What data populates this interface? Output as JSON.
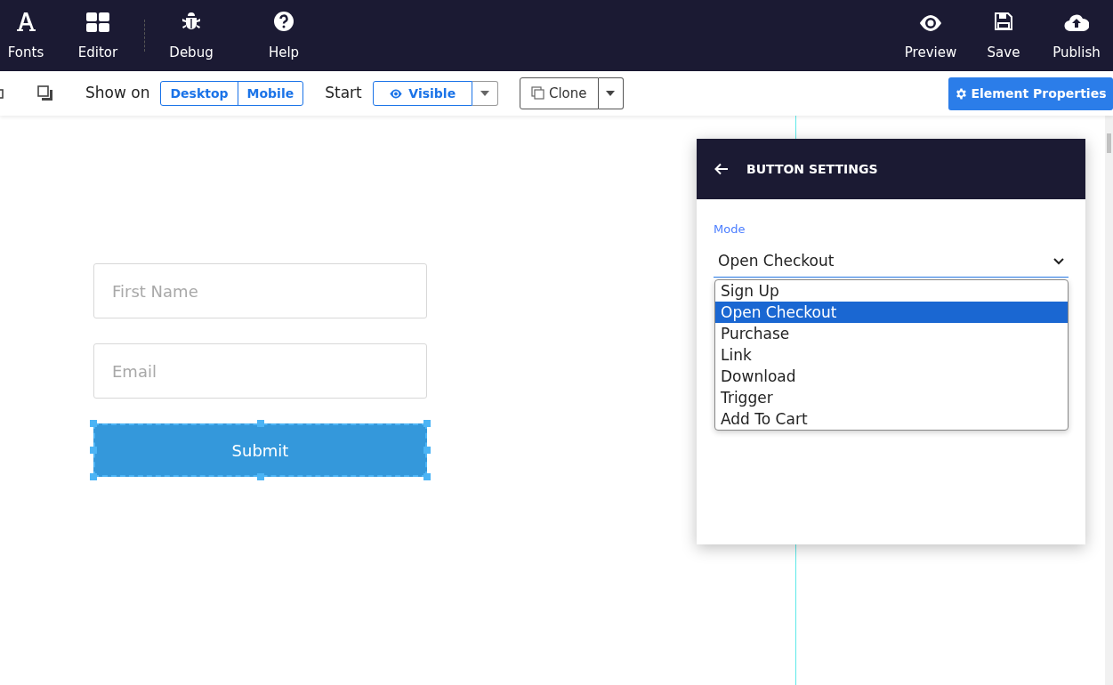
{
  "top_nav": {
    "left": [
      {
        "label": "Fonts",
        "kind": "fonts"
      },
      {
        "label": "Editor",
        "kind": "editor"
      },
      {
        "label": "Debug",
        "kind": "debug"
      },
      {
        "label": "Help",
        "kind": "help"
      }
    ],
    "right": [
      {
        "label": "Preview",
        "kind": "preview"
      },
      {
        "label": "Save",
        "kind": "save"
      },
      {
        "label": "Publish",
        "kind": "publish"
      }
    ]
  },
  "toolbar": {
    "show_on_label": "Show on",
    "show_on_options": [
      "Desktop",
      "Mobile"
    ],
    "start_label": "Start",
    "start_value": "Visible",
    "clone_label": "Clone",
    "properties_button": "Element Properties"
  },
  "form": {
    "fields": [
      {
        "placeholder": "First Name"
      },
      {
        "placeholder": "Email"
      }
    ],
    "submit": "Submit"
  },
  "panel": {
    "title": "BUTTON SETTINGS",
    "mode_label": "Mode",
    "mode_value": "Open Checkout",
    "options": [
      {
        "label": "Sign Up",
        "selected": false
      },
      {
        "label": "Open Checkout",
        "selected": true
      },
      {
        "label": "Purchase",
        "selected": false
      },
      {
        "label": "Link",
        "selected": false
      },
      {
        "label": "Download",
        "selected": false
      },
      {
        "label": "Trigger",
        "selected": false
      },
      {
        "label": "Add To Cart",
        "selected": false
      }
    ]
  }
}
